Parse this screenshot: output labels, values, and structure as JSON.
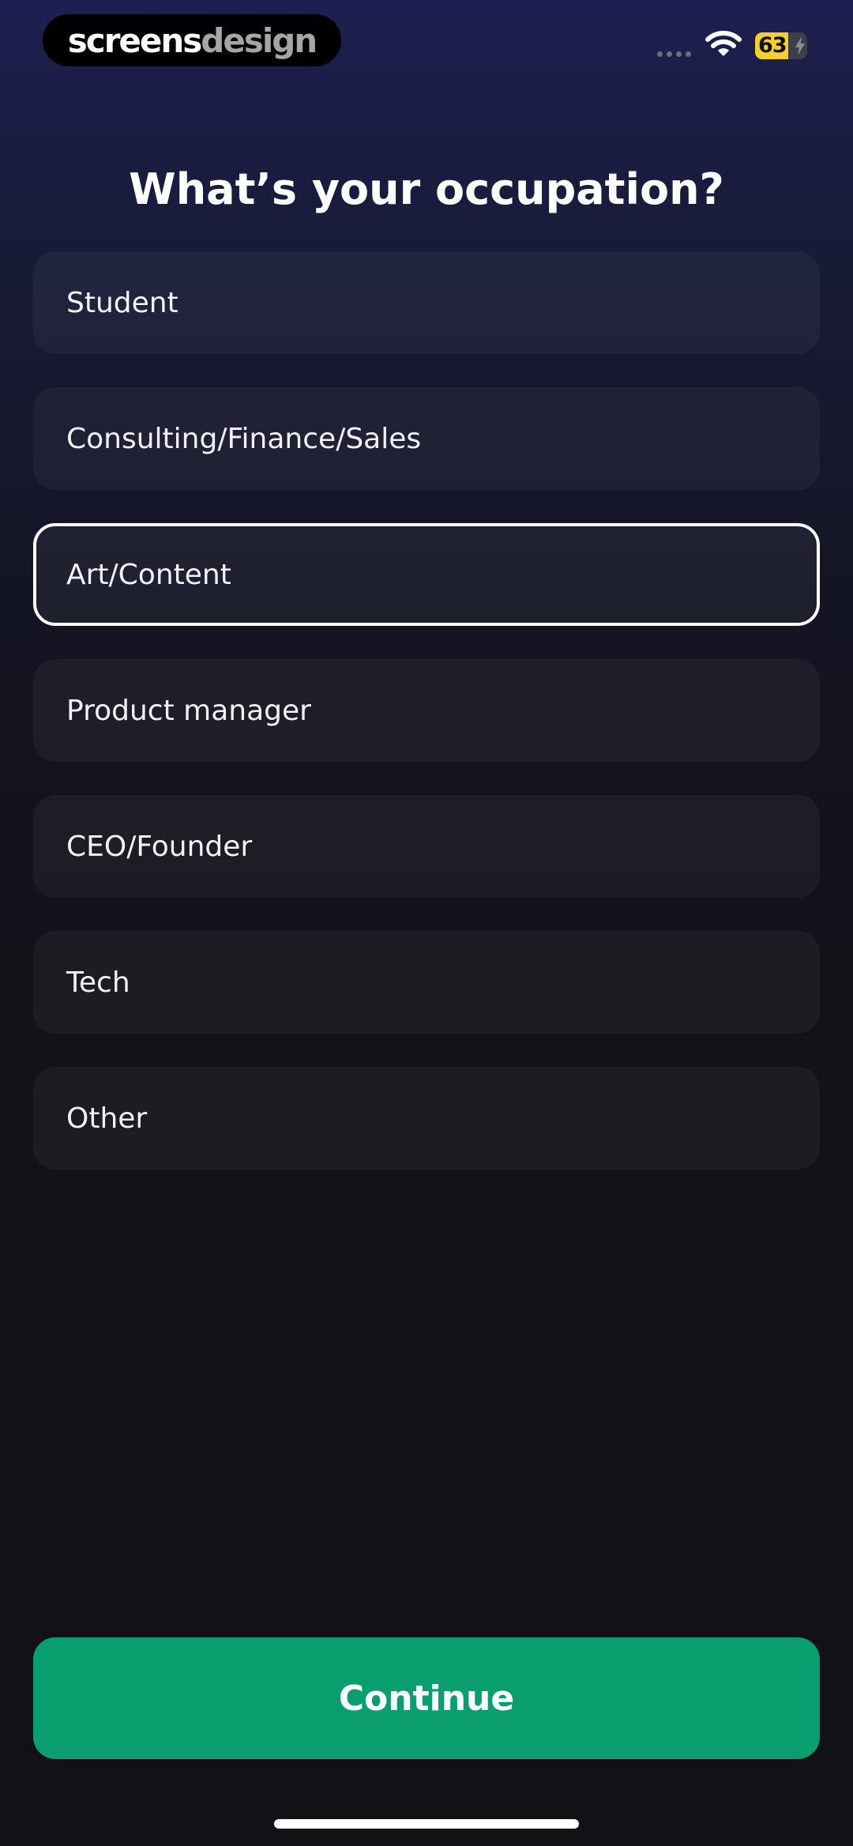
{
  "status_bar": {
    "brand_part1": "screens",
    "brand_part2": "design",
    "battery_level": "63",
    "battery_fraction": 0.63,
    "icons": [
      "signal-dots-icon",
      "wifi-icon",
      "battery-icon",
      "charging-bolt-icon"
    ]
  },
  "title": "What’s your occupation?",
  "options": [
    {
      "label": "Student",
      "selected": false
    },
    {
      "label": "Consulting/Finance/Sales",
      "selected": false
    },
    {
      "label": "Art/Content",
      "selected": true
    },
    {
      "label": "Product manager",
      "selected": false
    },
    {
      "label": "CEO/Founder",
      "selected": false
    },
    {
      "label": "Tech",
      "selected": false
    },
    {
      "label": "Other",
      "selected": false
    }
  ],
  "continue_label": "Continue",
  "colors": {
    "accent": "#0a9e6f",
    "battery": "#f3cf2f",
    "selected_border": "#ffffff"
  }
}
